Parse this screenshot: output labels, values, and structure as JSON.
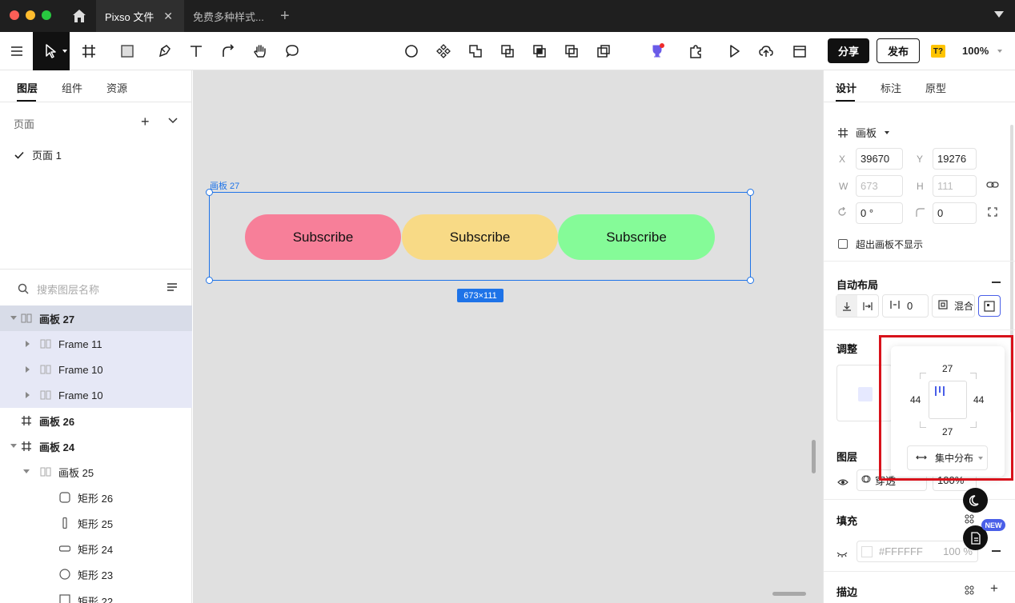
{
  "tabs": [
    {
      "label": "Pixso 文件"
    },
    {
      "label": "免费多种样式..."
    }
  ],
  "toolbar": {
    "share_label": "分享",
    "publish_label": "发布",
    "t_badge": "T?",
    "zoom": "100%"
  },
  "left_panel": {
    "tabs": [
      "图层",
      "组件",
      "资源"
    ],
    "pages_header": "页面",
    "page_item": "页面 1",
    "search_placeholder": "搜索图层名称",
    "layers": [
      {
        "name": "画板 27",
        "icon": "autolayout-icon"
      },
      {
        "name": "Frame 11",
        "icon": "autolayout-icon"
      },
      {
        "name": "Frame 10",
        "icon": "autolayout-icon"
      },
      {
        "name": "Frame 10",
        "icon": "autolayout-icon"
      },
      {
        "name": "画板 26",
        "icon": "frame-icon"
      },
      {
        "name": "画板 24",
        "icon": "frame-icon"
      },
      {
        "name": "画板 25",
        "icon": "autolayout-icon"
      },
      {
        "name": "矩形 26",
        "icon": "rounded-rect-icon"
      },
      {
        "name": "矩形 25",
        "icon": "tall-rect-icon"
      },
      {
        "name": "矩形 24",
        "icon": "pill-icon"
      },
      {
        "name": "矩形 23",
        "icon": "circle-icon"
      },
      {
        "name": "矩形 22",
        "icon": "rect-icon"
      }
    ]
  },
  "canvas": {
    "frame_label": "画板 27",
    "buttons": [
      {
        "label": "Subscribe",
        "color": "#f77f99"
      },
      {
        "label": "Subscribe",
        "color": "#f8da86"
      },
      {
        "label": "Subscribe",
        "color": "#85fb98"
      }
    ],
    "size_badge": "673×111"
  },
  "right_panel": {
    "tabs": [
      "设计",
      "标注",
      "原型"
    ],
    "frame_type": "画板",
    "x_label": "X",
    "x_value": "39670",
    "y_label": "Y",
    "y_value": "19276",
    "w_label": "W",
    "w_value": "673",
    "h_label": "H",
    "h_value": "111",
    "rotation": "0 °",
    "radius": "0",
    "clip_label": "超出画板不显示",
    "auto_layout_title": "自动布局",
    "spacing": "0",
    "mix_label": "混合",
    "adjust_title": "调整",
    "layer_title": "图层",
    "blend": "穿透",
    "opacity": "100%",
    "fill_title": "填充",
    "fill_hex": "#FFFFFF",
    "fill_opacity": "100 %",
    "stroke_title": "描边"
  },
  "popover": {
    "pad_top": "27",
    "pad_bottom": "27",
    "pad_left": "44",
    "pad_right": "44",
    "distribution": "集中分布"
  },
  "new_badge": "NEW"
}
